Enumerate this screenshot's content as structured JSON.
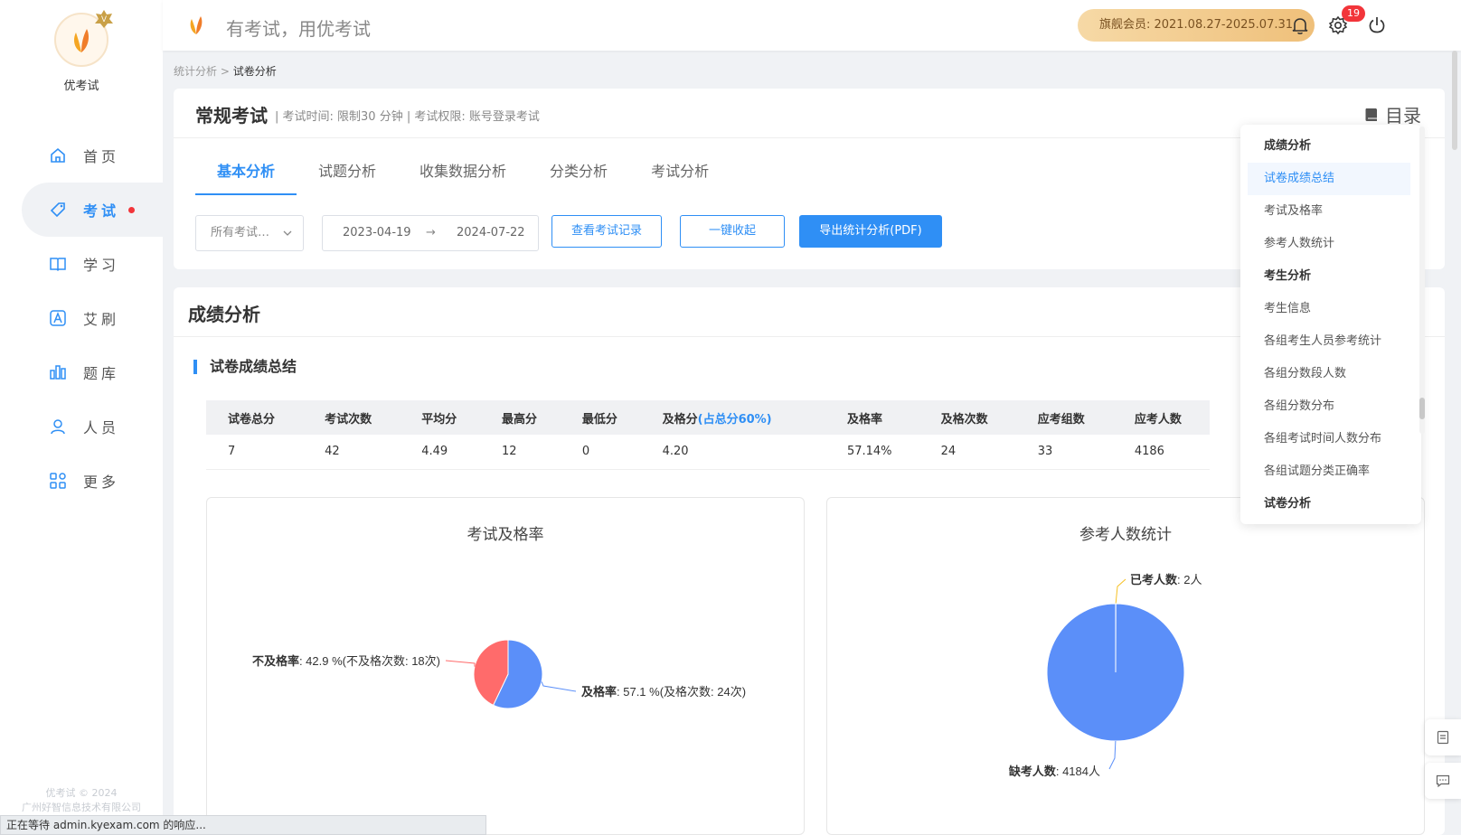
{
  "app": {
    "name": "优考试",
    "slogan": "有考试，用优考试",
    "membership": "旗舰会员: 2021.08.27-2025.07.31",
    "notification_count": "19"
  },
  "sidebar": {
    "items": [
      {
        "label": "首页",
        "icon": "home-icon"
      },
      {
        "label": "考试",
        "icon": "tag-icon"
      },
      {
        "label": "学习",
        "icon": "book-icon"
      },
      {
        "label": "艾刷",
        "icon": "a-icon"
      },
      {
        "label": "题库",
        "icon": "bar-chart-icon"
      },
      {
        "label": "人员",
        "icon": "user-icon"
      },
      {
        "label": "更多",
        "icon": "grid-icon"
      }
    ],
    "copyright": [
      "优考试 © 2024",
      "广州好智信息技术有限公司"
    ]
  },
  "breadcrumb": {
    "parent": "统计分析",
    "separator": ">",
    "current": "试卷分析"
  },
  "exam": {
    "title": "常规考试",
    "meta": "|  考试时间: 限制30 分钟  |  考试权限: 账号登录考试",
    "catalog_label": "目录",
    "tabs": [
      "基本分析",
      "试题分析",
      "收集数据分析",
      "分类分析",
      "考试分析"
    ],
    "select_value": "所有考试…",
    "date_from": "2023-04-19",
    "date_arrow": "→",
    "date_to": "2024-07-22",
    "buttons": {
      "view_records": "查看考试记录",
      "collapse_all": "一键收起",
      "export_pdf": "导出统计分析(PDF)"
    }
  },
  "score": {
    "section_title": "成绩分析",
    "sub_title": "试卷成绩总结",
    "table": {
      "headers": [
        "试卷总分",
        "考试次数",
        "平均分",
        "最高分",
        "最低分",
        "及格分",
        "及格率",
        "及格次数",
        "应考组数",
        "应考人数"
      ],
      "pass_score_note": "(占总分60%)",
      "row": [
        "7",
        "42",
        "4.49",
        "12",
        "0",
        "4.20",
        "57.14%",
        "24",
        "33",
        "4186"
      ]
    }
  },
  "chart_data": [
    {
      "type": "pie",
      "title": "考试及格率",
      "slices": [
        {
          "name": "及格率",
          "value": 57.1,
          "count": 24,
          "label": ": 57.1 %(及格次数: 24次)",
          "color": "#5b8ff9"
        },
        {
          "name": "不及格率",
          "value": 42.9,
          "count": 18,
          "label": ": 42.9 %(不及格次数: 18次)",
          "color": "#ff6b6b"
        }
      ]
    },
    {
      "type": "pie",
      "title": "参考人数统计",
      "slices": [
        {
          "name": "已考人数",
          "value": 2,
          "label": ": 2人",
          "color": "#f6c022"
        },
        {
          "name": "缺考人数",
          "value": 4184,
          "label": ": 4184人",
          "color": "#5b8ff9"
        }
      ]
    }
  ],
  "catalog": {
    "items": [
      {
        "label": "成绩分析",
        "type": "group"
      },
      {
        "label": "试卷成绩总结",
        "type": "selected"
      },
      {
        "label": "考试及格率",
        "type": "item"
      },
      {
        "label": "参考人数统计",
        "type": "item"
      },
      {
        "label": "考生分析",
        "type": "group"
      },
      {
        "label": "考生信息",
        "type": "item"
      },
      {
        "label": "各组考生人员参考统计",
        "type": "item"
      },
      {
        "label": "各组分数段人数",
        "type": "item"
      },
      {
        "label": "各组分数分布",
        "type": "item"
      },
      {
        "label": "各组考试时间人数分布",
        "type": "item"
      },
      {
        "label": "各组试题分类正确率",
        "type": "item"
      },
      {
        "label": "试卷分析",
        "type": "group"
      }
    ]
  },
  "status_bar": "正在等待 admin.kyexam.com 的响应..."
}
